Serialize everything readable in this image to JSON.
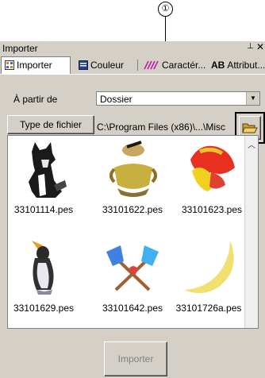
{
  "callout": {
    "number": "①"
  },
  "window": {
    "title": "Importer",
    "pin": "ᵖ",
    "close": "✕"
  },
  "tabs": [
    {
      "label": "Importer",
      "icon": "grid-icon",
      "active": true
    },
    {
      "label": "Couleur",
      "icon": "palette-icon",
      "active": false
    },
    {
      "label": "Caractér...",
      "icon": "stitch-icon",
      "active": false
    },
    {
      "label": "Attribut...",
      "icon": "ab-icon",
      "active": false,
      "prefix": "AB"
    }
  ],
  "source": {
    "label": "À partir de",
    "value": "Dossier"
  },
  "filetype": {
    "button_label": "Type de fichier",
    "path": "C:\\Program Files (x86)\\...\\Misc"
  },
  "files": [
    {
      "name": "33101114.pes",
      "icon": "wolf-icon"
    },
    {
      "name": "33101622.pes",
      "icon": "pot-icon"
    },
    {
      "name": "33101623.pes",
      "icon": "shoes-icon"
    },
    {
      "name": "33101629.pes",
      "icon": "penguin-icon"
    },
    {
      "name": "33101642.pes",
      "icon": "axes-icon"
    },
    {
      "name": "33101726a.pes",
      "icon": "moon-icon"
    }
  ],
  "import_button": {
    "label": "Importer",
    "enabled": false
  },
  "colors": {
    "panel": "#d4d0c8",
    "disabled_text": "#808080"
  }
}
